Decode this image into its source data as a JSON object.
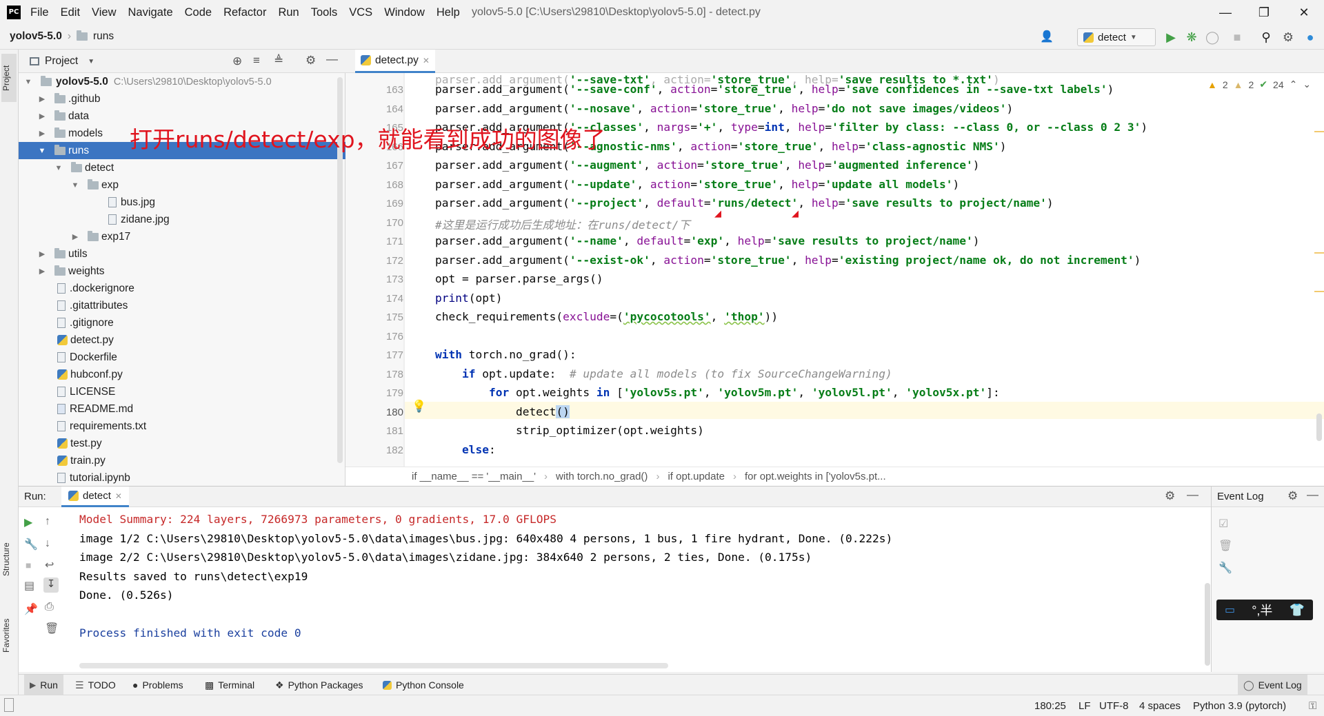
{
  "menubar": {
    "logo": "PC",
    "items": [
      "File",
      "Edit",
      "View",
      "Navigate",
      "Code",
      "Refactor",
      "Run",
      "Tools",
      "VCS",
      "Window",
      "Help"
    ],
    "window_title": "yolov5-5.0 [C:\\Users\\29810\\Desktop\\yolov5-5.0] - detect.py"
  },
  "navbar": {
    "project": "yolov5-5.0",
    "folder": "runs",
    "run_config": "detect"
  },
  "left_strip": {
    "project_tab": "Project",
    "structure_tab": "Structure",
    "favorites_tab": "Favorites"
  },
  "project_panel": {
    "title": "Project",
    "tree": [
      {
        "label": "yolov5-5.0",
        "path": "C:\\Users\\29810\\Desktop\\yolov5-5.0"
      },
      {
        "label": ".github"
      },
      {
        "label": "data"
      },
      {
        "label": "models"
      },
      {
        "label": "runs"
      },
      {
        "label": "detect"
      },
      {
        "label": "exp"
      },
      {
        "label": "bus.jpg"
      },
      {
        "label": "zidane.jpg"
      },
      {
        "label": "exp17"
      },
      {
        "label": "utils"
      },
      {
        "label": "weights"
      },
      {
        "label": ".dockerignore"
      },
      {
        "label": ".gitattributes"
      },
      {
        "label": ".gitignore"
      },
      {
        "label": "detect.py"
      },
      {
        "label": "Dockerfile"
      },
      {
        "label": "hubconf.py"
      },
      {
        "label": "LICENSE"
      },
      {
        "label": "README.md"
      },
      {
        "label": "requirements.txt"
      },
      {
        "label": "test.py"
      },
      {
        "label": "train.py"
      },
      {
        "label": "tutorial.ipynb"
      }
    ]
  },
  "editor": {
    "tab": "detect.py",
    "inspections": {
      "warn1": "2",
      "warn2": "2",
      "ok": "24"
    },
    "line_numbers": [
      "163",
      "164",
      "165",
      "166",
      "167",
      "168",
      "169",
      "170",
      "171",
      "172",
      "173",
      "174",
      "175",
      "176",
      "177",
      "178",
      "179",
      "180",
      "181",
      "182"
    ],
    "breadcrumbs": [
      "if __name__ == '__main__'",
      "with torch.no_grad()",
      "if opt.update",
      "for opt.weights in ['yolov5s.pt..."
    ]
  },
  "annotation": "打开runs/detect/exp，就能看到成功的图像了",
  "run_panel": {
    "label": "Run:",
    "tab": "detect",
    "lines": [
      "Model Summary: 224 layers, 7266973 parameters, 0 gradients, 17.0 GFLOPS",
      "image 1/2 C:\\Users\\29810\\Desktop\\yolov5-5.0\\data\\images\\bus.jpg: 640x480 4 persons, 1 bus, 1 fire hydrant, Done. (0.222s)",
      "image 2/2 C:\\Users\\29810\\Desktop\\yolov5-5.0\\data\\images\\zidane.jpg: 384x640 2 persons, 2 ties, Done. (0.175s)",
      "Results saved to runs\\detect\\exp19",
      "Done. (0.526s)",
      "",
      "Process finished with exit code 0"
    ]
  },
  "event_log": {
    "title": "Event Log"
  },
  "ime": {
    "chars": "°,半"
  },
  "bottom_tabs": [
    "Run",
    "TODO",
    "Problems",
    "Terminal",
    "Python Packages",
    "Python Console",
    "Event Log"
  ],
  "status": {
    "position": "180:25",
    "line_sep": "LF",
    "encoding": "UTF-8",
    "indent": "4 spaces",
    "interpreter": "Python 3.9 (pytorch)"
  },
  "colors": {
    "selection": "#3c75c2",
    "keyword": "#0033b3",
    "string": "#067d17",
    "comment": "#8c8c8c",
    "annotation": "#e0141e"
  }
}
